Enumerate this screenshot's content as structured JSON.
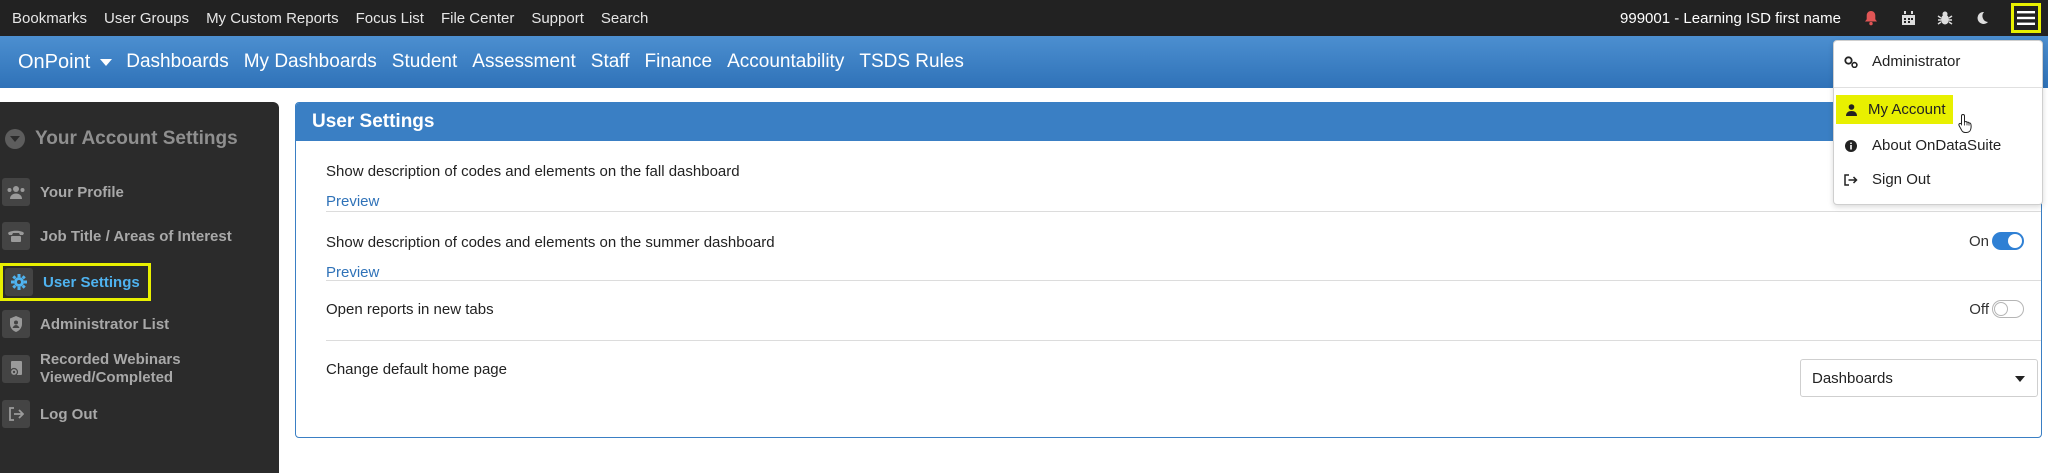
{
  "topbar": {
    "links": [
      "Bookmarks",
      "User Groups",
      "My Custom Reports",
      "Focus List",
      "File Center",
      "Support",
      "Search"
    ],
    "user_label": "999001 - Learning ISD first name",
    "icons": [
      "bell-icon",
      "calendar-icon",
      "bug-icon",
      "moon-icon",
      "hamburger-menu-icon"
    ],
    "colors": {
      "bell": "#e05555",
      "menu_highlight": "#e8f000"
    }
  },
  "navbar": {
    "brand": "OnPoint",
    "items": [
      "Dashboards",
      "My Dashboards",
      "Student",
      "Assessment",
      "Staff",
      "Finance",
      "Accountability",
      "TSDS Rules"
    ]
  },
  "sidebar": {
    "heading": "Your Account Settings",
    "items": [
      {
        "label": "Your Profile",
        "icon": "users-icon"
      },
      {
        "label": "Job Title / Areas of Interest",
        "icon": "phone-icon"
      },
      {
        "label": "User Settings",
        "icon": "gear-icon",
        "active": true
      },
      {
        "label": "Administrator List",
        "icon": "admin-shield-icon"
      },
      {
        "label": "Recorded Webinars Viewed/Completed",
        "icon": "webinar-icon"
      },
      {
        "label": "Log Out",
        "icon": "sign-out-icon"
      }
    ],
    "active_color": "#4fb3f0"
  },
  "panel": {
    "title": "User Settings",
    "rows": [
      {
        "label": "Show description of codes and elements on the fall dashboard",
        "preview": "Preview"
      },
      {
        "label": "Show description of codes and elements on the summer dashboard",
        "preview": "Preview",
        "toggle_text": "On"
      },
      {
        "label": "Open reports in new tabs",
        "toggle_text": "Off"
      },
      {
        "label": "Change default home page",
        "select_value": "Dashboards"
      }
    ],
    "accent": "#3a7fc4"
  },
  "dropdown": {
    "items": [
      {
        "label": "Administrator",
        "icon": "gears-icon"
      },
      {
        "label": "My Account",
        "icon": "user-icon"
      },
      {
        "label": "About OnDataSuite",
        "icon": "info-icon"
      },
      {
        "label": "Sign Out",
        "icon": "sign-out-icon"
      }
    ]
  }
}
